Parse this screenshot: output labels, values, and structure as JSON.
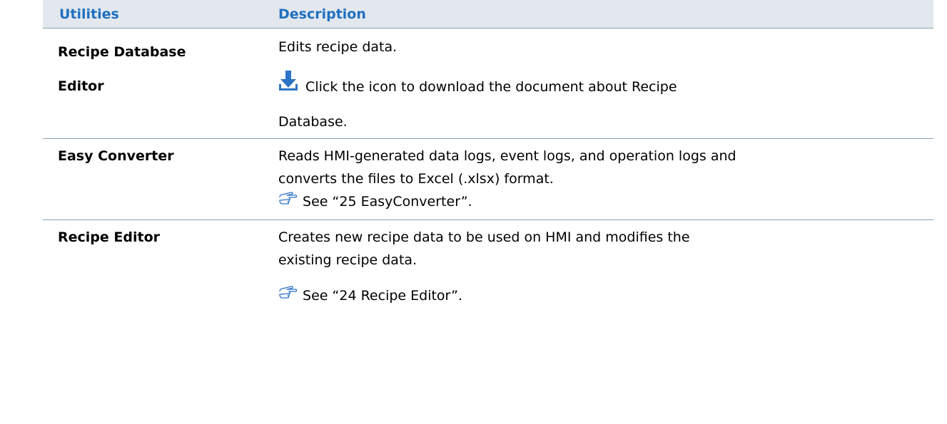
{
  "header": {
    "col1": "Utilities",
    "col2": "Description"
  },
  "rows": [
    {
      "name_line1": "Recipe Database",
      "name_line2": "Editor",
      "desc1": "Edits recipe data.",
      "desc2": "Click the icon to download the document about Recipe",
      "desc3": "Database.",
      "icon": "download-icon"
    },
    {
      "name_line1": "Easy Converter",
      "desc1": "Reads HMI-generated data logs, event logs, and operation logs and",
      "desc2": "converts the files to Excel (.xlsx) format.",
      "desc3": "See “25 EasyConverter”.",
      "icon": "pointing-hand-icon"
    },
    {
      "name_line1": "Recipe Editor",
      "desc1": "Creates new recipe data to be used on HMI and modifies the",
      "desc2": "existing recipe data.",
      "desc3": "See “24 Recipe Editor”.",
      "icon": "pointing-hand-icon"
    }
  ],
  "colors": {
    "header_bg": "#e2e8ed",
    "header_text": "#1f6fc0",
    "divider": "#8aa0b0",
    "icon_blue": "#2e74c6"
  }
}
